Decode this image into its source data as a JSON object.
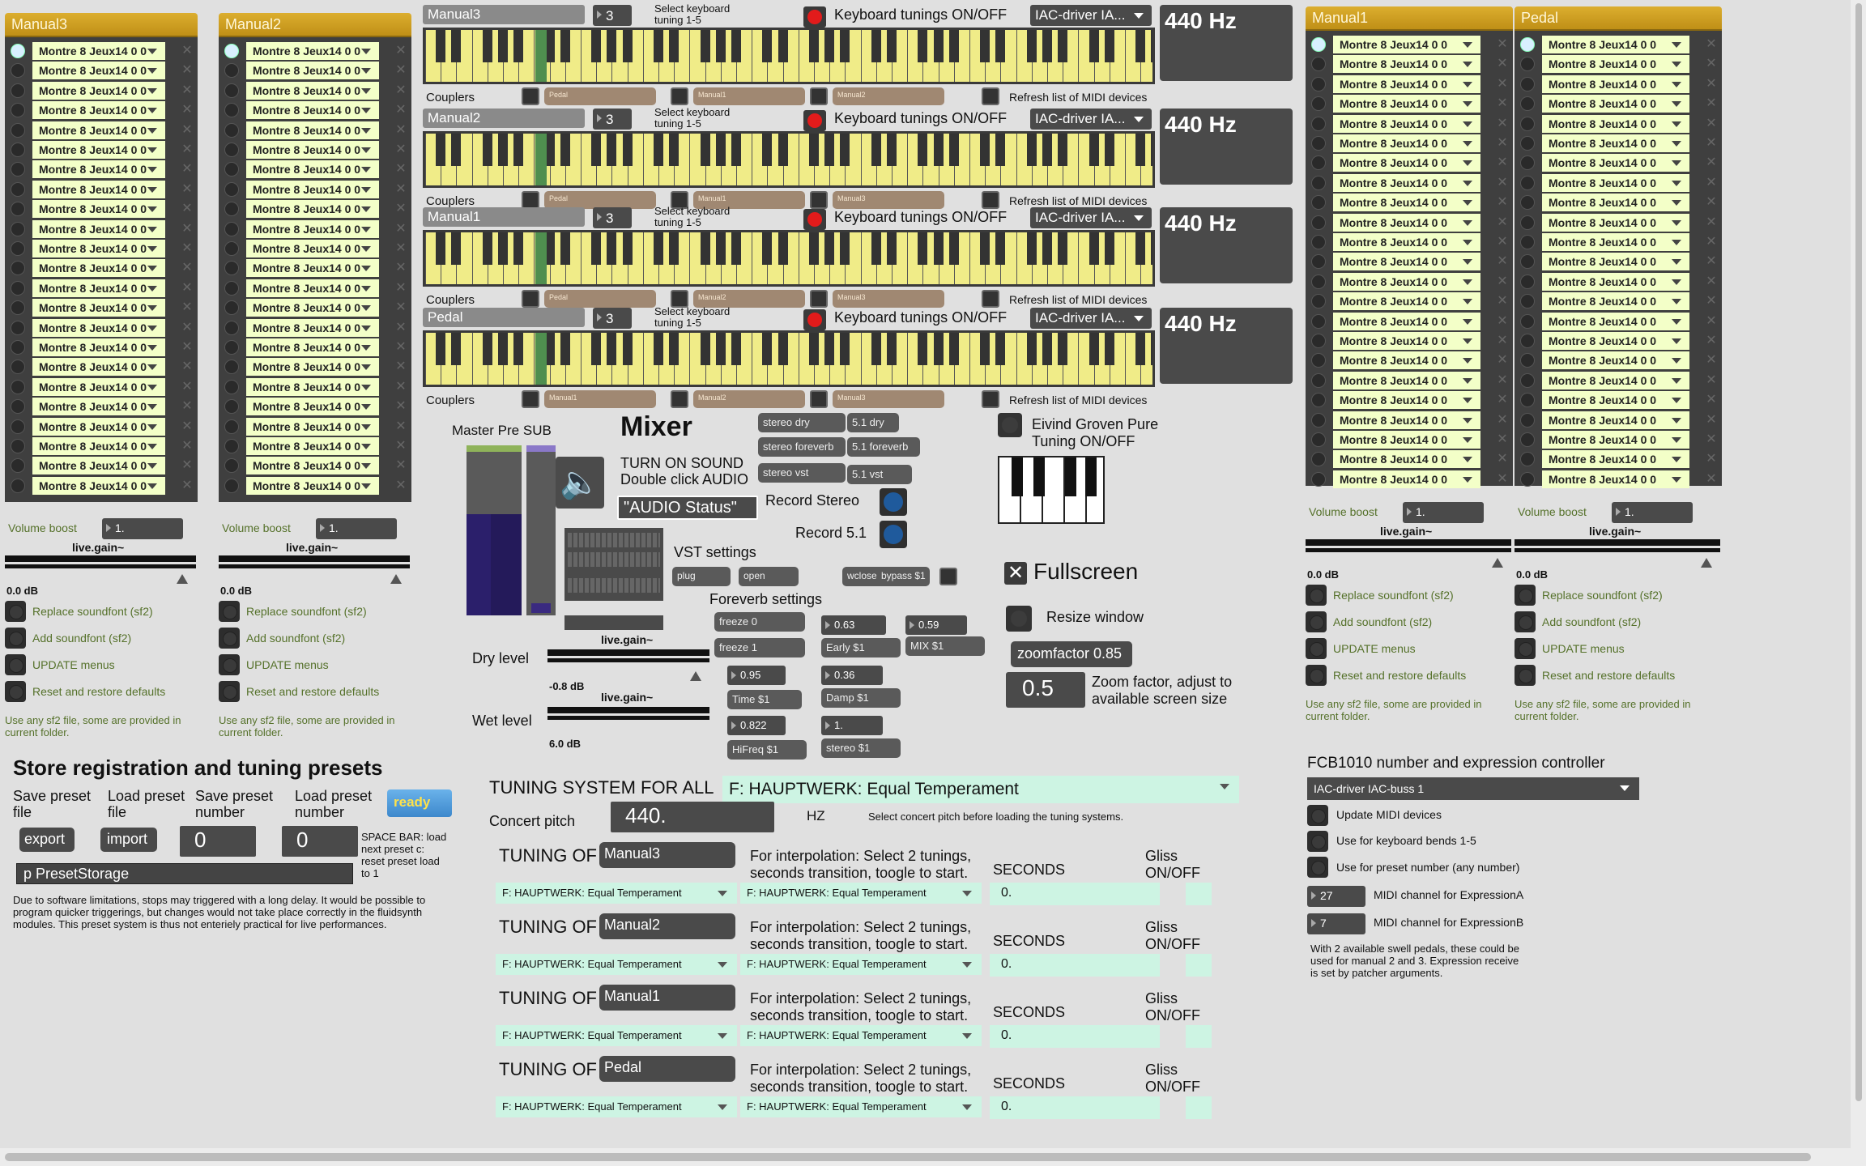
{
  "manual_panels": [
    {
      "title": "Manual3",
      "stop_label": "Montre 8 Jeux14 0 0",
      "volume_label": "Volume boost",
      "volume_value": "1.",
      "gain_label": "live.gain~",
      "db": "0.0 dB",
      "btn1": "Replace soundfont (sf2)",
      "btn2": "Add soundfont (sf2)",
      "btn3": "UPDATE menus",
      "btn4": "Reset and restore defaults",
      "note": "Use any sf2 file, some are provided in current folder."
    },
    {
      "title": "Manual2",
      "stop_label": "Montre 8 Jeux14 0 0",
      "volume_label": "Volume boost",
      "volume_value": "1.",
      "gain_label": "live.gain~",
      "db": "0.0 dB",
      "btn1": "Replace soundfont (sf2)",
      "btn2": "Add soundfont (sf2)",
      "btn3": "UPDATE menus",
      "btn4": "Reset and restore defaults",
      "note": "Use any sf2 file, some are provided in current folder."
    },
    {
      "title": "Manual1",
      "stop_label": "Montre 8 Jeux14 0 0",
      "volume_label": "Volume boost",
      "volume_value": "1.",
      "gain_label": "live.gain~",
      "db": "0.0 dB",
      "btn1": "Replace soundfont (sf2)",
      "btn2": "Add soundfont (sf2)",
      "btn3": "UPDATE menus",
      "btn4": "Reset and restore defaults",
      "note": "Use any sf2 file, some are provided in current folder."
    },
    {
      "title": "Pedal",
      "stop_label": "Montre 8 Jeux14 0 0",
      "volume_label": "Volume boost",
      "volume_value": "1.",
      "gain_label": "live.gain~",
      "db": "0.0 dB",
      "btn1": "Replace soundfont (sf2)",
      "btn2": "Add soundfont (sf2)",
      "btn3": "UPDATE menus",
      "btn4": "Reset and restore defaults",
      "note": "Use any sf2 file, some are provided in current folder."
    }
  ],
  "keyboards": [
    {
      "name": "Manual3",
      "number": "3",
      "sel_text": "Select keyboard tuning 1-5",
      "toggle_label": "Keyboard tunings ON/OFF",
      "midi": "IAC-driver IA...",
      "hz": "440 Hz",
      "couplers": "Couplers",
      "c1": "Pedal",
      "c2": "Manual1",
      "c3": "Manual2",
      "refresh": "Refresh list of MIDI devices"
    },
    {
      "name": "Manual2",
      "number": "3",
      "sel_text": "Select keyboard tuning 1-5",
      "toggle_label": "Keyboard tunings ON/OFF",
      "midi": "IAC-driver IA...",
      "hz": "440 Hz",
      "couplers": "Couplers",
      "c1": "Pedal",
      "c2": "Manual1",
      "c3": "Manual3",
      "refresh": "Refresh list of MIDI devices"
    },
    {
      "name": "Manual1",
      "number": "3",
      "sel_text": "Select keyboard tuning 1-5",
      "toggle_label": "Keyboard tunings ON/OFF",
      "midi": "IAC-driver IA...",
      "hz": "440 Hz",
      "couplers": "Couplers",
      "c1": "Pedal",
      "c2": "Manual2",
      "c3": "Manual3",
      "refresh": "Refresh list of MIDI devices"
    },
    {
      "name": "Pedal",
      "number": "3",
      "sel_text": "Select keyboard tuning 1-5",
      "toggle_label": "Keyboard tunings ON/OFF",
      "midi": "IAC-driver IA...",
      "hz": "440 Hz",
      "couplers": "Couplers",
      "c1": "Manual1",
      "c2": "Manual2",
      "c3": "Manual3",
      "refresh": "Refresh list of MIDI devices"
    }
  ],
  "mixer": {
    "title": "Mixer",
    "master": "Master Pre SUB",
    "turn_on": "TURN ON SOUND",
    "double_click": "Double click AUDIO",
    "audio_status": "\"AUDIO Status\"",
    "record_stereo": "Record Stereo",
    "record_51": "Record 5.1",
    "vst_settings": "VST settings",
    "foreverb_settings": "Foreverb settings",
    "dry_level": "Dry level",
    "wet_level": "Wet level",
    "gain": "live.gain~",
    "dry_db": "-0.8 dB",
    "wet_db": "6.0 dB",
    "routing": [
      "stereo dry",
      "5.1 dry",
      "stereo foreverb",
      "5.1 foreverb",
      "stereo vst",
      "5.1 vst"
    ],
    "vst_buttons": [
      "plug",
      "open",
      "wclose",
      "bypass $1"
    ],
    "freeze": [
      "freeze 0",
      "freeze 1"
    ],
    "fv_vals": [
      "0.63",
      "0.59",
      "0.36",
      "0.95",
      "0.822",
      "1."
    ],
    "fv_labels": [
      "Early $1",
      "MIX $1",
      "Damp $1",
      "Time $1",
      "HiFreq $1",
      "stereo $1"
    ]
  },
  "right_ctrl": {
    "eivind": "Eivind Groven Pure Tuning ON/OFF",
    "fullscreen": "Fullscreen",
    "resize": "Resize window",
    "zoomfactor": "zoomfactor 0.85",
    "zoom_val": "0.5",
    "zoom_text": "Zoom factor, adjust to available screen size"
  },
  "presets": {
    "title": "Store registration and tuning presets",
    "save_file": "Save preset file",
    "load_file": "Load preset file",
    "save_num": "Save preset number",
    "load_num": "Load preset number",
    "ready": "ready",
    "export": "export",
    "import": "import",
    "save_val": "0",
    "load_val": "0",
    "space": "SPACE BAR: load next preset c: reset preset load to 1",
    "storage": "p PresetStorage",
    "note": "Due to software limitations, stops may triggered with a long delay. It would be possible to program quicker triggerings, but changes would not take place correctly in the fluidsynth modules. This preset system is thus not enteriely practical for live performances."
  },
  "tuning": {
    "title": "TUNING SYSTEM FOR ALL",
    "system": "F: HAUPTWERK: Equal Temperament",
    "concert": "Concert pitch",
    "pitch": "440.",
    "hz": "HZ",
    "hint": "Select concert pitch before loading the tuning systems.",
    "of": "TUNING OF",
    "interp": "For interpolation: Select 2 tunings, seconds transition, toogle to start.",
    "seconds": "SECONDS",
    "gliss": "Gliss ON/OFF",
    "seconds_val": "0.",
    "dropdown": "F: HAUPTWERK: Equal Temperament",
    "rows": [
      "Manual3",
      "Manual2",
      "Manual1",
      "Pedal"
    ]
  },
  "fcb": {
    "title": "FCB1010 number and expression controller",
    "device": "IAC-driver IAC-buss 1",
    "update": "Update MIDI devices",
    "bends": "Use for keyboard bends 1-5",
    "preset": "Use for preset number (any number)",
    "chA_val": "27",
    "chA": "MIDI channel for ExpressionA",
    "chB_val": "7",
    "chB": "MIDI channel for ExpressionB",
    "note": "With 2 available swell pedals, these could be used for manual 2 and 3. Expression receive is set by patcher arguments."
  }
}
